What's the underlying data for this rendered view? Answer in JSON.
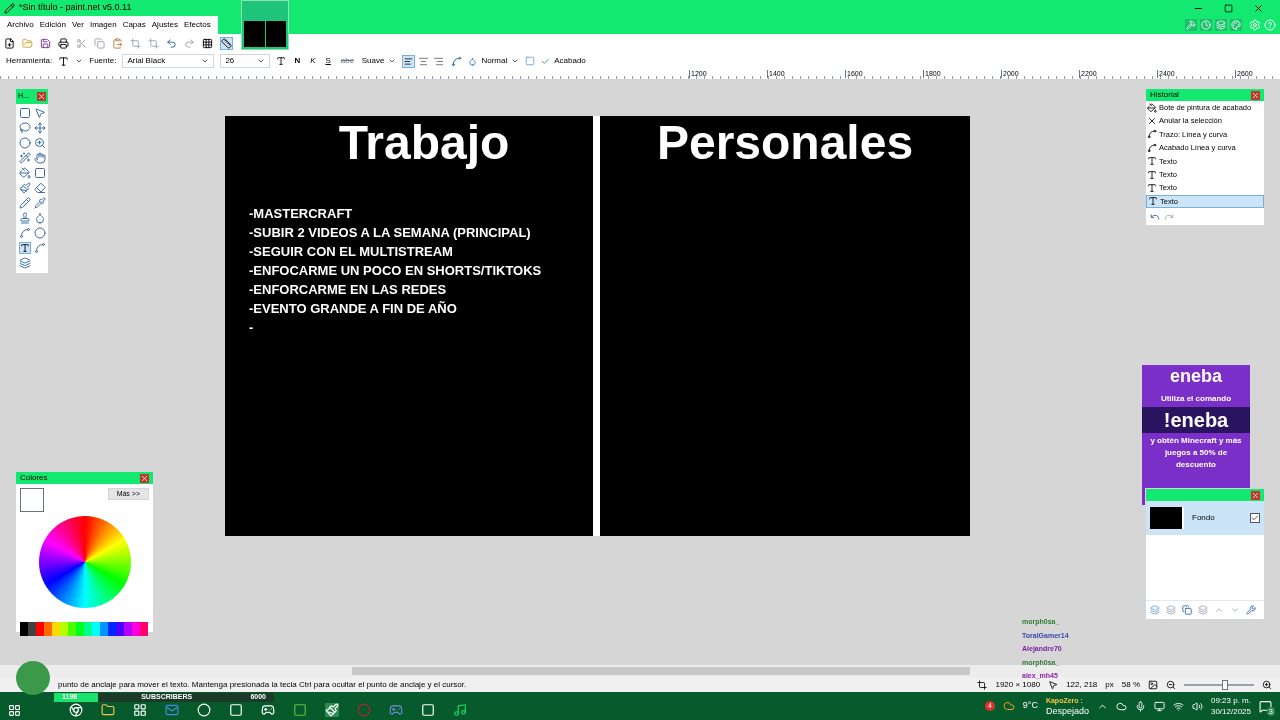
{
  "window": {
    "title": "*Sin título - paint.net v5.0.11"
  },
  "menu": [
    "Archivo",
    "Edición",
    "Ver",
    "Imagen",
    "Capas",
    "Ajustes",
    "Efectos"
  ],
  "image_tab": {
    "selected": true
  },
  "options": {
    "tool_label": "Herramienta:",
    "font_label": "Fuente:",
    "font": "Arial Black",
    "size": "26",
    "bold": "N",
    "italic": "K",
    "underline": "S",
    "strike": "abc",
    "antialias": "Suave",
    "blend": "Normal",
    "finish": "Acabado",
    "align": [
      {
        "selected": true
      },
      {
        "selected": false
      },
      {
        "selected": false
      }
    ]
  },
  "ruler": [
    "1200",
    "1400",
    "1600",
    "1800",
    "2000",
    "2200",
    "2400",
    "2600"
  ],
  "canvas": {
    "left_title": "Trabajo",
    "right_title": "Personales",
    "items": [
      "-MASTERCRAFT",
      "-SUBIR 2 VIDEOS A LA SEMANA (PRINCIPAL)",
      "-SEGUIR CON EL MULTISTREAM",
      "-ENFOCARME UN POCO EN SHORTS/TIKTOKS",
      "-ENFORCARME EN LAS REDES",
      "-EVENTO GRANDE A FIN DE AÑO",
      "-"
    ]
  },
  "tools_window": {
    "title": "H...",
    "tools": [
      {
        "selected": false
      },
      {
        "selected": false
      },
      {
        "selected": false
      },
      {
        "selected": false
      },
      {
        "selected": false
      },
      {
        "selected": false
      },
      {
        "selected": false
      },
      {
        "selected": false
      },
      {
        "selected": false
      },
      {
        "selected": false
      },
      {
        "selected": false
      },
      {
        "selected": false
      },
      {
        "selected": false
      },
      {
        "selected": false
      },
      {
        "selected": false
      },
      {
        "selected": false
      },
      {
        "selected": false
      },
      {
        "selected": false
      },
      {
        "selected": true
      },
      {
        "selected": false
      },
      {
        "selected": false
      }
    ]
  },
  "colors_window": {
    "title": "Colores",
    "more": "Más >>"
  },
  "history": {
    "title": "Historial",
    "items": [
      {
        "label": "Bote de pintura de acabado",
        "kind": "bucket",
        "selected": false
      },
      {
        "label": "Anular la selección",
        "kind": "deselect",
        "selected": false
      },
      {
        "label": "Trazo: Línea y curva",
        "kind": "curve",
        "selected": false
      },
      {
        "label": "Acabado Línea y curva",
        "kind": "curve",
        "selected": false
      },
      {
        "label": "Texto",
        "kind": "text",
        "selected": false
      },
      {
        "label": "Texto",
        "kind": "text",
        "selected": false
      },
      {
        "label": "Texto",
        "kind": "text",
        "selected": false
      },
      {
        "label": "Texto",
        "kind": "text",
        "selected": true
      }
    ]
  },
  "promo": {
    "brand": "eneba",
    "line1": "Utiliza el comando",
    "command": "!eneba",
    "line2": "y obtén Minecraft y más juegos a 50% de descuento"
  },
  "layers": {
    "items": [
      {
        "name": "Fondo",
        "visible": true,
        "selected": true
      }
    ]
  },
  "chat": [
    {
      "user": "morph0sa_",
      "color": "#2e7d32"
    },
    {
      "user": "ToralGamer14",
      "color": "#3949ab"
    },
    {
      "user": "Alejandre70",
      "color": "#7b1fa2"
    },
    {
      "user": "morph0sa_",
      "color": "#2e7d32"
    },
    {
      "user": "alex_mh45",
      "color": "#8e24aa"
    }
  ],
  "status": {
    "hint": "punto de anclaje para mover el texto. Mantenga presionada la tecla Ctrl para ocultar el punto de anclaje y el cursor.",
    "size": "1920 × 1080",
    "pos": "122, 218",
    "unit": "px",
    "zoom": "58 %"
  },
  "zoom_slider": {
    "level": 0.6
  },
  "subscribers": {
    "count": "1198",
    "label": "SUBSCRIBERS",
    "goal": "6000",
    "level": 0.2
  },
  "taskbar": {
    "weather_badge": "4",
    "temp": "9°C",
    "weather": "Despejado",
    "chat_user": "KapoZero :",
    "time": "09:23 p. m.",
    "date": "30/12/2025",
    "notif": "3"
  }
}
